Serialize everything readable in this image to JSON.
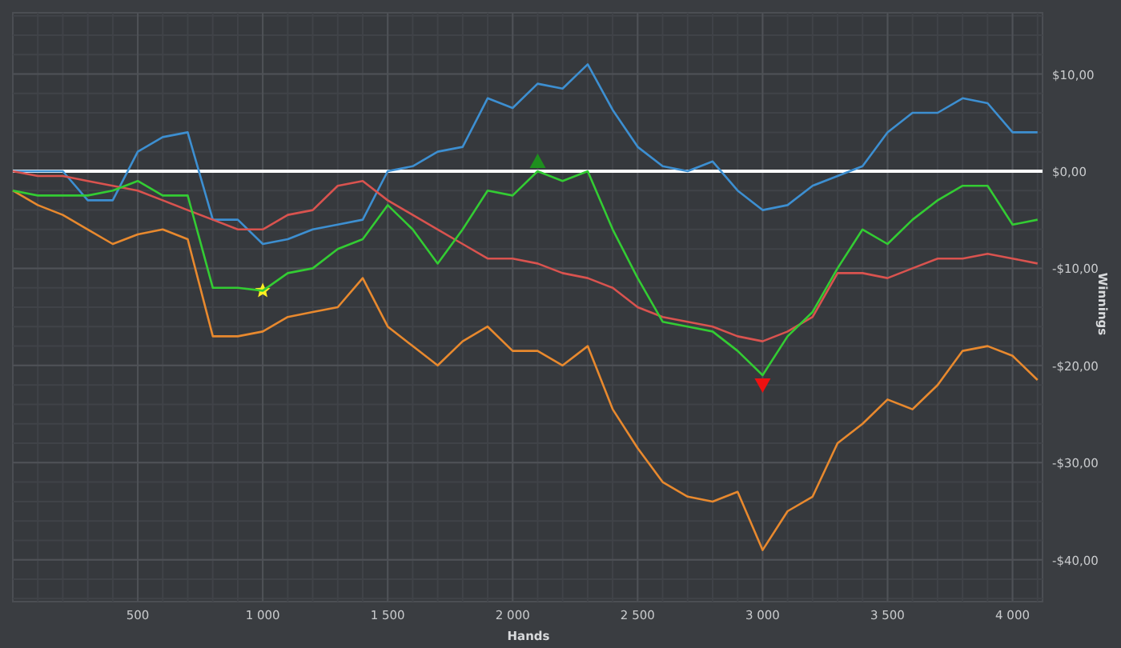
{
  "chart": {
    "chart_data": {
      "type": "line",
      "xlabel": "Hands",
      "ylabel": "Winnings",
      "x": [
        0,
        100,
        200,
        300,
        400,
        500,
        600,
        700,
        800,
        900,
        1000,
        1100,
        1200,
        1300,
        1400,
        1500,
        1600,
        1700,
        1800,
        1900,
        2000,
        2100,
        2200,
        2300,
        2400,
        2500,
        2600,
        2700,
        2800,
        2900,
        3000,
        3100,
        3200,
        3300,
        3400,
        3500,
        3600,
        3700,
        3800,
        3900,
        4000,
        4100
      ],
      "series": [
        {
          "color": "#3d8fd1",
          "values": [
            0,
            0,
            0,
            -3,
            -3,
            2,
            3.5,
            4,
            -5,
            -5,
            -7.5,
            -7,
            -6,
            -5.5,
            -5,
            0,
            0.5,
            2,
            2.5,
            7.5,
            6.5,
            9,
            8.5,
            11,
            6.3,
            2.5,
            0.5,
            0,
            1,
            -2,
            -4,
            -3.5,
            -1.5,
            -0.5,
            0.5,
            4,
            6,
            6,
            7.5,
            7,
            4,
            4
          ]
        },
        {
          "color": "#d9534f",
          "values": [
            0,
            -0.5,
            -0.5,
            -1,
            -1.5,
            -2,
            -3,
            -4,
            -5,
            -6,
            -6,
            -4.5,
            -4,
            -1.5,
            -1,
            -3,
            -4.5,
            -6,
            -7.5,
            -9,
            -9,
            -9.5,
            -10.5,
            -11,
            -12,
            -14,
            -15,
            -15.5,
            -16,
            -17,
            -17.5,
            -16.5,
            -15,
            -10.5,
            -10.5,
            -11,
            -10,
            -9,
            -9,
            -8.5,
            -9,
            -9.5
          ]
        },
        {
          "color": "#e8892e",
          "values": [
            -2,
            -3.5,
            -4.5,
            -6,
            -7.5,
            -6.5,
            -6,
            -7,
            -17,
            -17,
            -16.5,
            -15,
            -14.5,
            -14,
            -11,
            -16,
            -18,
            -20,
            -17.5,
            -16,
            -18.5,
            -18.5,
            -20,
            -18,
            -24.5,
            -28.5,
            -32,
            -33.5,
            -34,
            -33,
            -39,
            -35,
            -33.5,
            -28,
            -26,
            -23.5,
            -24.5,
            -22,
            -18.5,
            -18,
            -19,
            -21.5
          ]
        },
        {
          "color": "#33cc33",
          "values": [
            -2,
            -2.5,
            -2.5,
            -2.5,
            -2,
            -1,
            -2.5,
            -2.5,
            -12,
            -12,
            -12.3,
            -10.5,
            -10,
            -8,
            -7,
            -3.5,
            -6,
            -9.5,
            -6,
            -2,
            -2.5,
            0,
            -1,
            0,
            -6,
            -11,
            -15.5,
            -16,
            -16.5,
            -18.5,
            -21,
            -17,
            -14.5,
            -10,
            -6,
            -7.5,
            -5,
            -3,
            -1.5,
            -1.5,
            -5.5,
            -5
          ]
        }
      ],
      "xlim": [
        0,
        4120
      ],
      "ylim": [
        -44.3,
        16.3
      ],
      "xticks": [
        {
          "value": 500,
          "label": "500"
        },
        {
          "value": 1000,
          "label": "1 000"
        },
        {
          "value": 1500,
          "label": "1 500"
        },
        {
          "value": 2000,
          "label": "2 000"
        },
        {
          "value": 2500,
          "label": "2 500"
        },
        {
          "value": 3000,
          "label": "3 000"
        },
        {
          "value": 3500,
          "label": "3 500"
        },
        {
          "value": 4000,
          "label": "4 000"
        }
      ],
      "yticks": [
        {
          "value": 10,
          "label": "$10,00"
        },
        {
          "value": 0,
          "label": "$0,00"
        },
        {
          "value": -10,
          "label": "-$10,00"
        },
        {
          "value": -20,
          "label": "-$20,00"
        },
        {
          "value": -30,
          "label": "-$30,00"
        },
        {
          "value": -40,
          "label": "-$40,00"
        }
      ],
      "grid": true
    }
  }
}
